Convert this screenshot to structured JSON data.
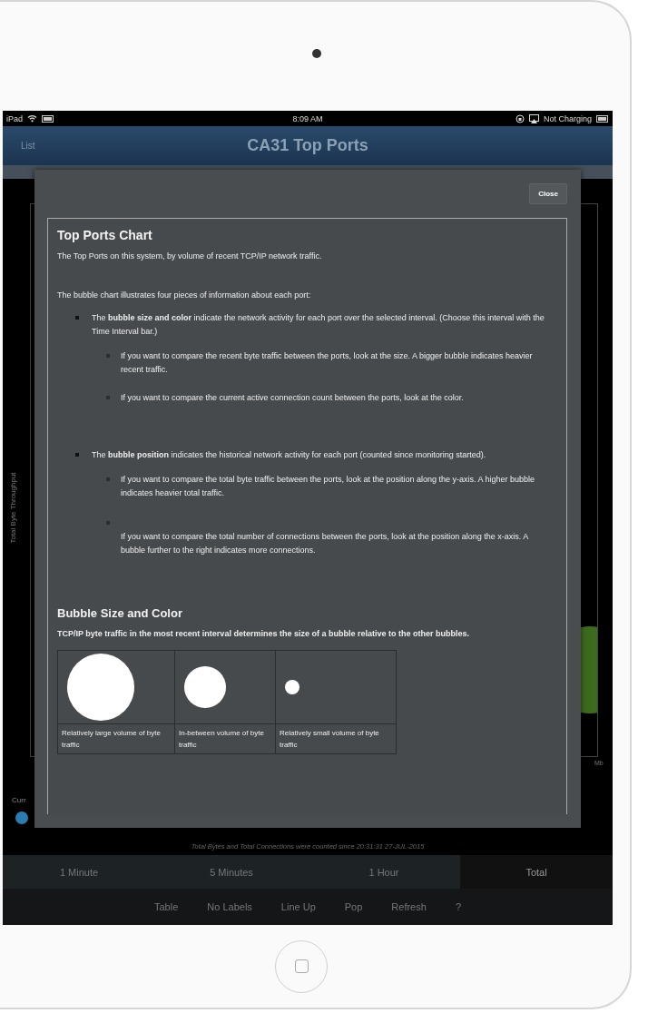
{
  "status_bar": {
    "device": "iPad",
    "time": "8:09 AM",
    "charging": "Not Charging"
  },
  "nav_bar": {
    "back": "List",
    "title": "CA31 Top Ports"
  },
  "chart_background": {
    "y_axis_label": "Total Byte Throughput",
    "x_axis_unit": "Mb",
    "legend_label": "Curr"
  },
  "help_dialog": {
    "close": "Close",
    "title": "Top Ports Chart",
    "intro": "The Top Ports on this system, by volume of recent TCP/IP network traffic.",
    "lead": "The bubble chart illustrates four pieces of information about each port:",
    "points": [
      {
        "text": "The **bubble size and color** indicate the network activity for each port over the selected interval. (Choose this interval with the Time Interval bar.)",
        "children": [
          {
            "text": "If you want to compare the recent byte traffic between the ports, look at the size. A bigger bubble indicates heavier recent traffic.",
            "marker_alone": false
          },
          {
            "text": "If you want to compare the current active connection count between the ports, look at the color.",
            "marker_alone": false
          }
        ]
      },
      {
        "text": "The **bubble position** indicates the historical network activity for each port (counted since monitoring started).",
        "children": [
          {
            "text": "If you want to compare the total byte traffic between the ports, look at the position along the y-axis. A higher bubble indicates heavier total traffic.",
            "marker_alone": false
          },
          {
            "text": "If you want to compare the total number of connections between the ports, look at the position along the x-axis. A bubble further to the right indicates more connections.",
            "marker_alone": true
          }
        ]
      }
    ],
    "section_title": "Bubble Size and Color",
    "section_text": "TCP/IP byte traffic in the most recent interval determines the size of a bubble relative to the other bubbles.",
    "bubble_sizes": [
      {
        "kind": "large",
        "caption": "Relatively large volume of byte traffic"
      },
      {
        "kind": "medium",
        "caption": "In-between volume of byte traffic"
      },
      {
        "kind": "small",
        "caption": "Relatively small volume of byte traffic"
      }
    ]
  },
  "footnote": "Total Bytes and Total Connections were counted since 20:31:31 27-JUL-2015",
  "intervals": [
    {
      "label": "1 Minute",
      "selected": false
    },
    {
      "label": "5 Minutes",
      "selected": false
    },
    {
      "label": "1 Hour",
      "selected": false
    },
    {
      "label": "Total",
      "selected": true
    }
  ],
  "toolbar": [
    "Table",
    "No Labels",
    "Line Up",
    "Pop",
    "Refresh",
    "?"
  ]
}
